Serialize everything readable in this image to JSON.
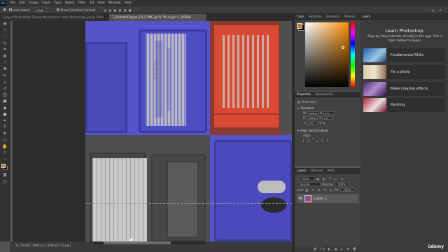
{
  "menubar": {
    "logo": "Ps",
    "items": [
      "File",
      "Edit",
      "Image",
      "Layer",
      "Type",
      "Select",
      "Filter",
      "3D",
      "View",
      "Window",
      "Help"
    ]
  },
  "options": {
    "auto_select": "Auto-Select:",
    "layer": "Layer",
    "transform": "Show Transform Controls"
  },
  "tabs": [
    {
      "label": "Copy of Black White Simple Monochrome Initial Name Logo.jpg @ 100% (Layer 1, RGB/8)"
    },
    {
      "label": "T_ShieldedFlapper_D1_C.PNG @ 51.7% (Layer 1, RGB/8)"
    }
  ],
  "status": {
    "text": "51.7%  Doc: 4096 px x 4096 px (72 ppi)"
  },
  "color_panel": {
    "tabs": [
      "Color",
      "Swatches",
      "Gradients",
      "Patterns"
    ],
    "fg": "#c07a2a",
    "bg": "#000000"
  },
  "properties_panel": {
    "tabs": [
      "Properties",
      "Adjustments"
    ],
    "layer_type": "Pixel Layer",
    "transform_title": "Transform",
    "w": "4096 px",
    "h": "4096 px",
    "x": "0 px",
    "y": "0 px",
    "angle": "0.00°",
    "align_title": "Align and Distribute",
    "align_sub": "Align:"
  },
  "layers_panel": {
    "tabs": [
      "Layers",
      "Channels",
      "Paths"
    ],
    "kind": "Kind",
    "blend": "Normal",
    "opacity_label": "Opacity:",
    "opacity": "100%",
    "lock_label": "Lock:",
    "fill_label": "Fill:",
    "fill": "100%",
    "layer_name": "Layer 1"
  },
  "learn_panel": {
    "tab": "Learn",
    "title": "Learn Photoshop",
    "desc": "Step-by-step tutorials directly in the app. Pick a topic below to begin.",
    "cards": [
      {
        "label": "Fundamental Skills"
      },
      {
        "label": "Fix a photo"
      },
      {
        "label": "Make creative effects"
      },
      {
        "label": "Painting"
      }
    ]
  },
  "canvas_text": {
    "label1": "MOLO"
  },
  "watermark": "ûdemy",
  "colors": {
    "blue": "#5553c9",
    "red": "#d84a34",
    "gray": "#4e4e4e"
  }
}
